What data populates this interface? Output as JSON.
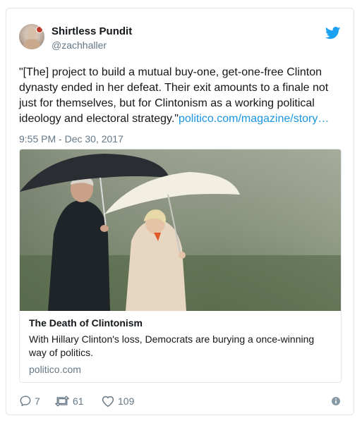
{
  "author": {
    "name": "Shirtless Pundit",
    "handle": "@zachhaller"
  },
  "tweet": {
    "text": "\"[The] project to build a mutual buy-one, get-one-free Clinton dynasty ended in her defeat. Their exit amounts to a finale not just for themselves, but for Clintonism as a working political ideology and electoral strategy.\"",
    "link_text": "politico.com/magazine/story…",
    "timestamp": "9:55 PM - Dec 30, 2017"
  },
  "link_card": {
    "title": "The Death of Clintonism",
    "description": "With Hillary Clinton's loss, Democrats are burying a once-winning way of politics.",
    "domain": "politico.com"
  },
  "actions": {
    "replies": "7",
    "retweets": "61",
    "likes": "109"
  },
  "icons": {
    "brand": "twitter-bird-icon",
    "reply": "reply-icon",
    "retweet": "retweet-icon",
    "like": "heart-icon",
    "info": "info-icon"
  },
  "colors": {
    "accent": "#1b95e0",
    "secondary_text": "#657786",
    "border": "#e1e8ed"
  }
}
